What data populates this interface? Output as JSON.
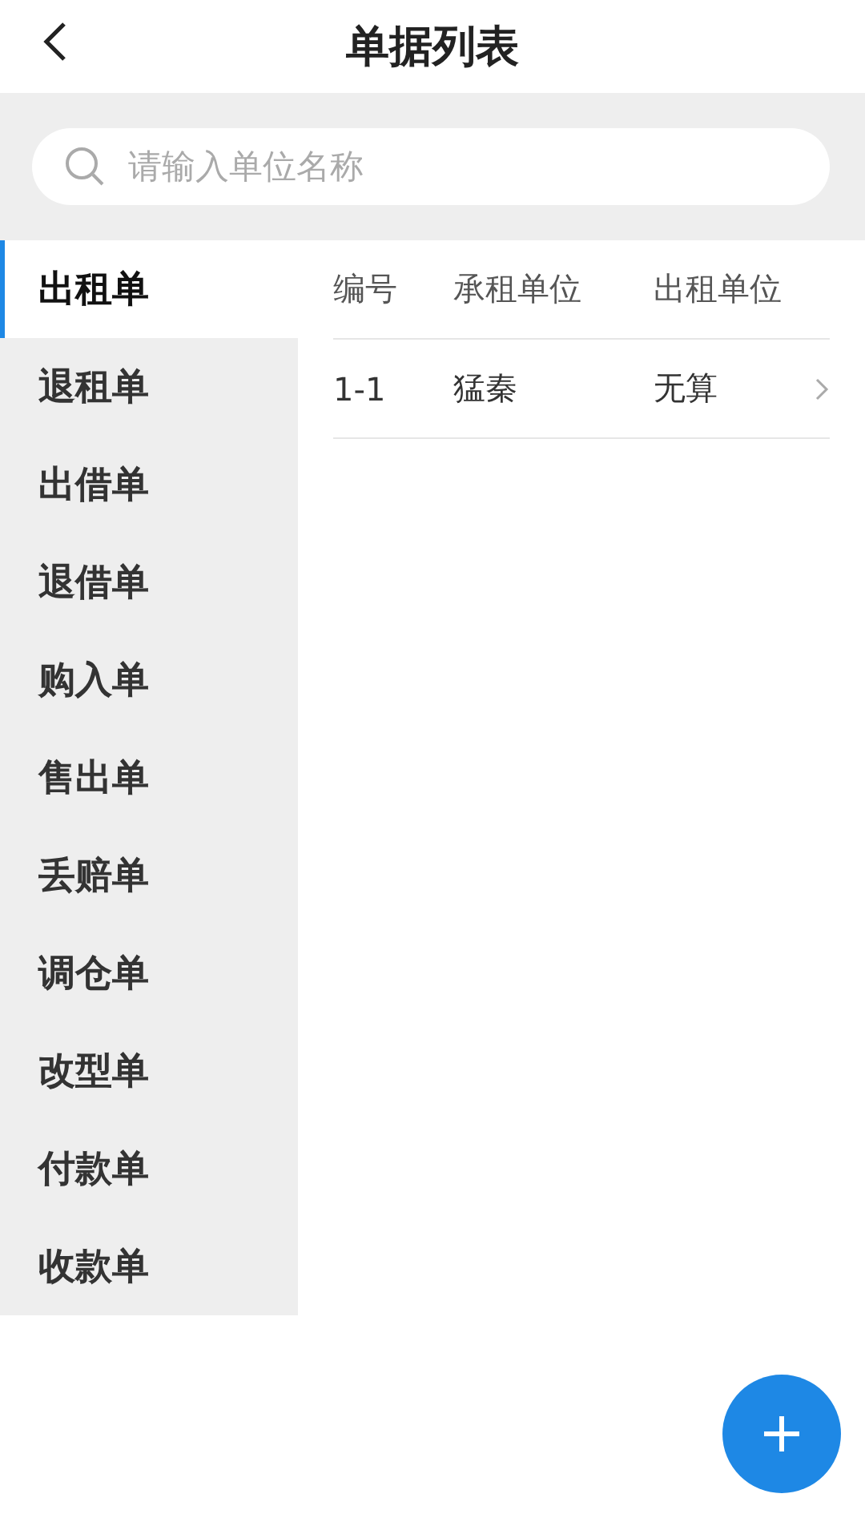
{
  "header": {
    "title": "单据列表"
  },
  "search": {
    "placeholder": "请输入单位名称"
  },
  "sidebar": {
    "items": [
      {
        "label": "出租单",
        "selected": true
      },
      {
        "label": "退租单",
        "selected": false
      },
      {
        "label": "出借单",
        "selected": false
      },
      {
        "label": "退借单",
        "selected": false
      },
      {
        "label": "购入单",
        "selected": false
      },
      {
        "label": "售出单",
        "selected": false
      },
      {
        "label": "丢赔单",
        "selected": false
      },
      {
        "label": "调仓单",
        "selected": false
      },
      {
        "label": "改型单",
        "selected": false
      },
      {
        "label": "付款单",
        "selected": false
      },
      {
        "label": "收款单",
        "selected": false
      }
    ]
  },
  "table": {
    "columns": [
      "编号",
      "承租单位",
      "出租单位"
    ],
    "rows": [
      {
        "cells": [
          "1-1",
          "猛秦",
          "无算"
        ]
      }
    ]
  }
}
